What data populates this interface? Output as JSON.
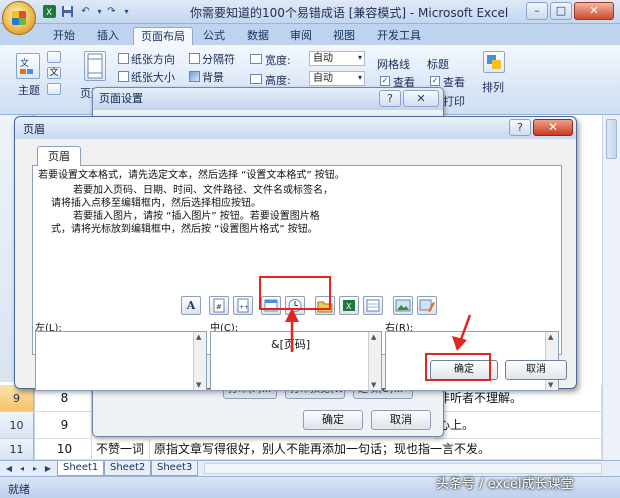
{
  "window": {
    "title": "你需要知道的100个易错成语  [兼容模式] - Microsoft Excel",
    "min": "–",
    "max": "□",
    "close": "✕"
  },
  "tabs": [
    "开始",
    "插入",
    "页面布局",
    "公式",
    "数据",
    "审阅",
    "视图",
    "开发工具"
  ],
  "ribbon": {
    "theme_label": "主题",
    "margins_label": "页边距",
    "orientation": "纸张方向",
    "size": "纸张大小",
    "breaks": "分隔符",
    "background": "背景",
    "width_label": "宽度:",
    "width_value": "自动",
    "height_label": "高度:",
    "height_value": "自动",
    "gridlines": "网格线",
    "headings": "标题",
    "view1": "查看",
    "view2": "查看",
    "print": "打印",
    "arrange": "排列"
  },
  "sheet": {
    "rows": [
      {
        "num": "9",
        "col_b": "8",
        "col_c": "",
        "col_d": "",
        "col_e": "非听者不理解。",
        "selected": true
      },
      {
        "num": "10",
        "col_b": "9",
        "col_c": "",
        "col_d": "",
        "col_e": "心上。",
        "selected": false
      },
      {
        "num": "11",
        "col_b": "10",
        "col_c": "不赞一词",
        "col_d": "原指文章写得很好，别人不能再添加一句话；现也指一言不发。",
        "col_e": "",
        "selected": false
      }
    ],
    "tabs": [
      "Sheet1",
      "Sheet2",
      "Sheet3"
    ],
    "status": "就绪"
  },
  "page_setup": {
    "title": "页面设置",
    "help": "?",
    "close": "✕",
    "ok": "确定",
    "cancel": "取消",
    "partial1": "打印(P)...",
    "partial2": "打印预览(W)",
    "partial3": "选项(O)..."
  },
  "header_dialog": {
    "title": "页眉",
    "help": "?",
    "close": "✕",
    "tab": "页眉",
    "instructions": [
      "若要设置文本格式，请先选定文本，然后选择 “设置文本格式” 按钮。",
      "若要加入页码、日期、时间、文件路径、文件名或标签名，",
      "请将插入点移至编辑框内，然后选择相应按钮。",
      "若要插入图片，请按 “插入图片” 按钮。若要设置图片格",
      "式，请将光标放到编辑框中，然后按 “设置图片格式” 按钮。"
    ],
    "left_label": "左(L):",
    "center_label": "中(C):",
    "right_label": "右(R):",
    "center_content": "&[页码]",
    "ok": "确定",
    "cancel": "取消"
  },
  "watermark": "头条号 / excel成长课堂",
  "colors": {
    "annotation_red": "#e3241f",
    "accent_blue": "#2b579a"
  }
}
